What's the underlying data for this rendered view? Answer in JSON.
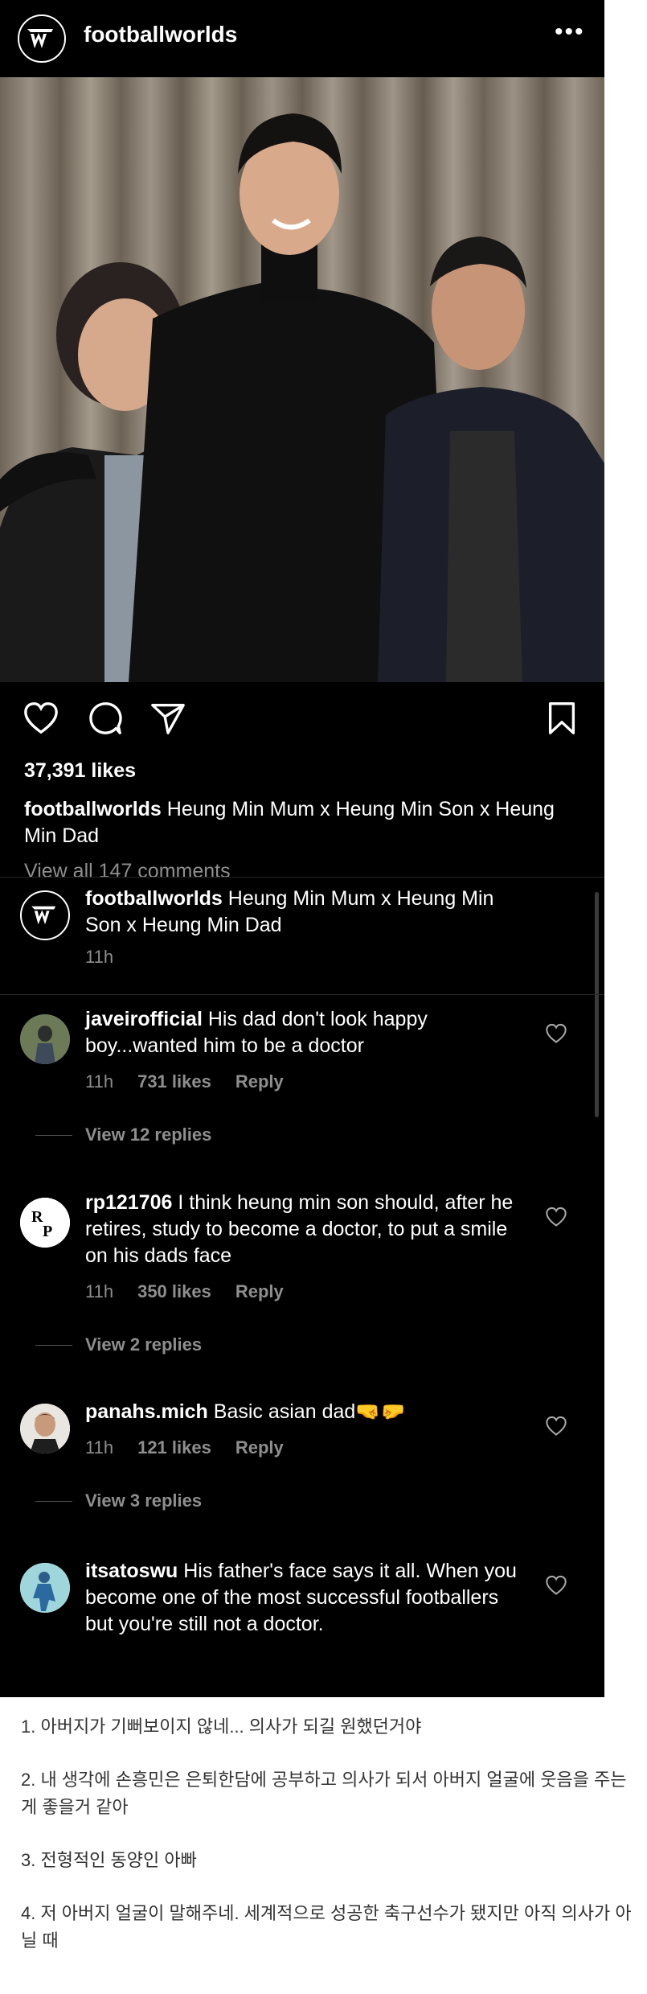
{
  "header": {
    "username": "footballworlds",
    "more_glyph": "•••"
  },
  "post": {
    "likes": "37,391 likes",
    "caption_user": "footballworlds",
    "caption_text": " Heung Min Mum x Heung Min Son x Heung Min Dad",
    "view_all": "View all 147 comments"
  },
  "icons": [
    "heart-icon",
    "comment-icon",
    "share-icon",
    "bookmark-icon",
    "more-icon"
  ],
  "comments": [
    {
      "user": "footballworlds",
      "text": " Heung Min Mum x Heung Min Son x Heung Min Dad",
      "time": "11h"
    },
    {
      "user": "javeirofficial",
      "text": " His dad don't look happy boy...wanted him to be a doctor",
      "time": "11h",
      "likes": "731 likes",
      "reply": "Reply",
      "view_replies": "View 12 replies"
    },
    {
      "user": "rp121706",
      "text": " I think heung min son should, after he retires, study to become a doctor, to put a smile on his dads face",
      "time": "11h",
      "likes": "350 likes",
      "reply": "Reply",
      "view_replies": "View 2 replies"
    },
    {
      "user": "panahs.mich",
      "text": " Basic asian dad🤜🤛",
      "time": "11h",
      "likes": "121 likes",
      "reply": "Reply",
      "view_replies": "View 3 replies"
    },
    {
      "user": "itsatoswu",
      "text": " His father's face says it all. When you become one of the most successful footballers but you're still not a doctor."
    }
  ],
  "translations": [
    "1. 아버지가 기뻐보이지 않네... 의사가 되길 원했던거야",
    "2. 내 생각에 손흥민은 은퇴한담에 공부하고 의사가 되서 아버지 얼굴에 웃음을 주는게 좋을거 같아",
    "3. 전형적인 동양인 아빠",
    "4. 저 아버지 얼굴이 말해주네. 세계적으로 성공한 축구선수가 됐지만 아직 의사가 아닐 때"
  ]
}
